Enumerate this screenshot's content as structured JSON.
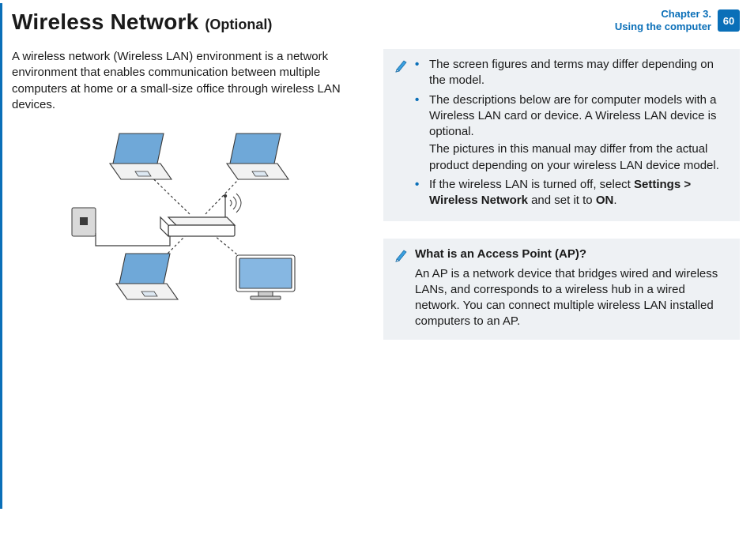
{
  "header": {
    "title": "Wireless Network",
    "optional": "(Optional)",
    "chapter_line1": "Chapter 3.",
    "chapter_line2": "Using the computer",
    "page_number": "60"
  },
  "left": {
    "intro": "A wireless network (Wireless LAN) environment is a network environment that enables communication between multiple computers at home or a small-size office through wireless LAN devices."
  },
  "note1": {
    "b1": "The screen figures and terms may differ depending on the model.",
    "b2a": "The descriptions below are for computer models with a Wireless LAN card or device. A Wireless LAN device is optional.",
    "b2b": "The pictures in this manual may differ from the actual product depending on your wireless LAN device model.",
    "b3_pre": "If the wireless LAN is turned off, select ",
    "b3_bold1": "Settings > Wireless Network",
    "b3_mid": " and set it to ",
    "b3_bold2": "ON",
    "b3_post": "."
  },
  "note2": {
    "title": "What is an Access Point (AP)?",
    "body": "An AP is a network device that bridges wired and wireless LANs, and corresponds to a wireless hub in a wired network. You can connect multiple wireless LAN installed computers to an AP."
  }
}
